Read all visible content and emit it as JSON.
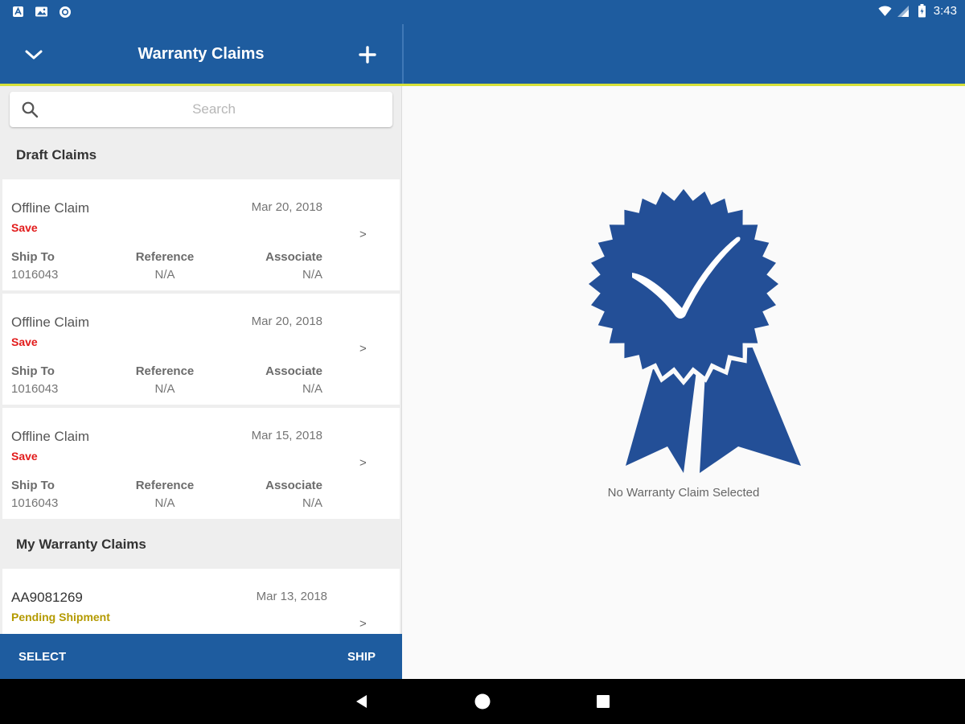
{
  "status_bar": {
    "time": "3:43",
    "left_icons": [
      "app-notification-icon",
      "image-notification-icon",
      "sync-notification-icon"
    ],
    "right_icons": [
      "wifi-icon",
      "cell-signal-icon",
      "battery-icon"
    ]
  },
  "header": {
    "title": "Warranty Claims",
    "collapse_icon": "chevron-down-icon",
    "add_icon": "plus-icon"
  },
  "search": {
    "placeholder": "Search",
    "value": ""
  },
  "sections": {
    "draft_title": "Draft Claims",
    "mine_title": "My Warranty Claims"
  },
  "draft_claims": [
    {
      "title": "Offline Claim",
      "status": "Save",
      "date": "Mar 20, 2018",
      "chevron": ">",
      "ship_to_label": "Ship To",
      "ship_to": "1016043",
      "reference_label": "Reference",
      "reference": "N/A",
      "associate_label": "Associate",
      "associate": "N/A"
    },
    {
      "title": "Offline Claim",
      "status": "Save",
      "date": "Mar 20, 2018",
      "chevron": ">",
      "ship_to_label": "Ship To",
      "ship_to": "1016043",
      "reference_label": "Reference",
      "reference": "N/A",
      "associate_label": "Associate",
      "associate": "N/A"
    },
    {
      "title": "Offline Claim",
      "status": "Save",
      "date": "Mar 15, 2018",
      "chevron": ">",
      "ship_to_label": "Ship To",
      "ship_to": "1016043",
      "reference_label": "Reference",
      "reference": "N/A",
      "associate_label": "Associate",
      "associate": "N/A"
    }
  ],
  "my_claims": [
    {
      "title": "AA9081269",
      "status": "Pending Shipment",
      "date": "Mar 13, 2018",
      "chevron": ">"
    }
  ],
  "bottom_bar": {
    "select_label": "SELECT",
    "ship_label": "SHIP"
  },
  "detail": {
    "empty_message": "No Warranty Claim Selected",
    "badge_icon": "award-ribbon-check-icon"
  },
  "colors": {
    "primary": "#1e5c9f",
    "accent": "#d6e13a",
    "status_save": "#e21b1b",
    "status_pending": "#b49a00",
    "badge": "#234f97"
  }
}
